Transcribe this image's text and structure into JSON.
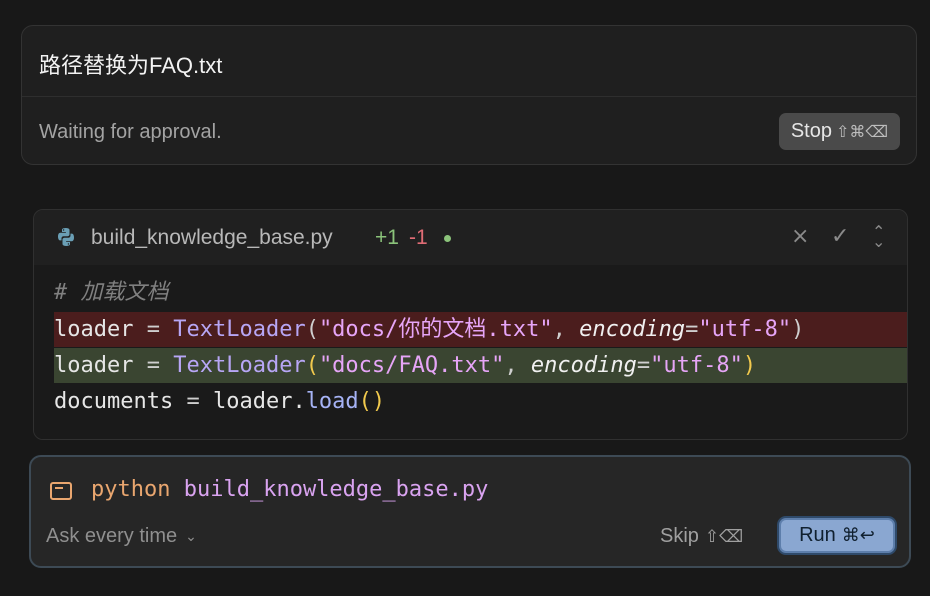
{
  "task": {
    "title": "路径替换为FAQ.txt",
    "status": "Waiting for approval.",
    "stop_label": "Stop",
    "stop_shortcut": "⇧⌘⌫"
  },
  "diff": {
    "file_name": "build_knowledge_base.py",
    "additions": "+1",
    "deletions": "-1",
    "icons": {
      "file": "python-icon",
      "close": "close-icon",
      "accept": "check-icon",
      "expand": "expand-icon"
    },
    "close_glyph": "×",
    "accept_glyph": "✓",
    "expand_glyph": "⌃⌄",
    "lines": {
      "comment": "# 加载文档",
      "removed": {
        "var": "loader",
        "op": " = ",
        "cls": "TextLoader",
        "open": "(",
        "str1": "\"docs/你的文档.txt\"",
        "sep": ", ",
        "kw": "encoding",
        "eq": "=",
        "str2": "\"utf-8\"",
        "close": ")"
      },
      "added": {
        "var": "loader",
        "op": " = ",
        "cls": "TextLoader",
        "open": "(",
        "str1": "\"docs/FAQ.txt\"",
        "sep": ", ",
        "kw": "encoding",
        "eq": "=",
        "str2": "\"utf-8\"",
        "close": ")"
      },
      "plain": {
        "var": "documents",
        "op": " = ",
        "obj": "loader.",
        "fn": "load",
        "parens": "()"
      }
    }
  },
  "terminal": {
    "cmd_program": "python",
    "cmd_arg": "build_knowledge_base.py",
    "ask_label": "Ask every time",
    "ask_chevron": "⌄",
    "skip_label": "Skip",
    "skip_shortcut": "⇧⌫",
    "run_label": "Run",
    "run_shortcut": "⌘↩"
  },
  "colors": {
    "background": "#181818",
    "removed_bg": "#4b1d1d",
    "added_bg": "#3a4531",
    "run_button": "#8aa7d1",
    "addition": "#8bc37a",
    "deletion": "#e06c75"
  }
}
